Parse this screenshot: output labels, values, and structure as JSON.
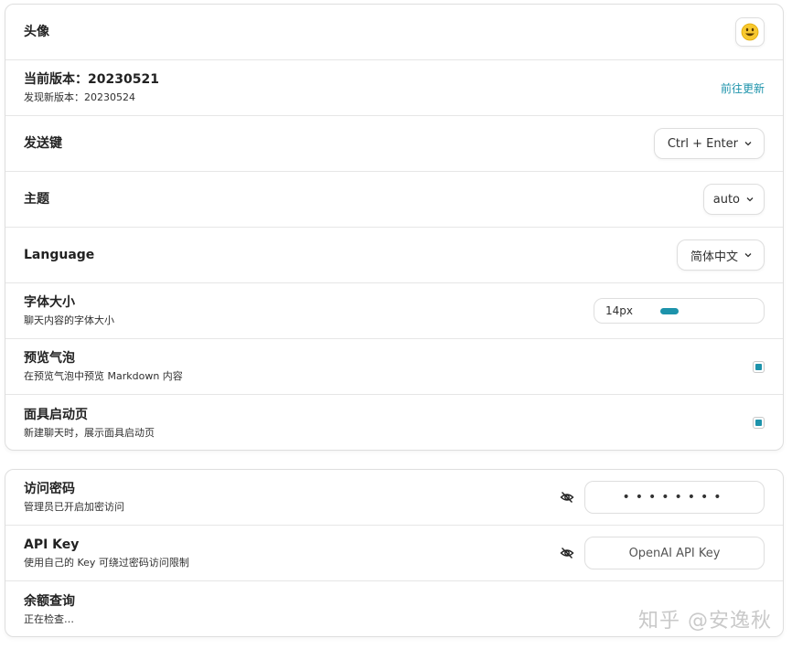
{
  "settings_card": {
    "avatar": {
      "label": "头像",
      "emoji": "😃"
    },
    "version": {
      "label": "当前版本：20230521",
      "sub": "发现新版本：20230524",
      "update_link": "前往更新"
    },
    "send_key": {
      "label": "发送键",
      "value": "Ctrl + Enter"
    },
    "theme": {
      "label": "主题",
      "value": "auto"
    },
    "language": {
      "label": "Language",
      "value": "简体中文"
    },
    "font_size": {
      "label": "字体大小",
      "sub": "聊天内容的字体大小",
      "value": "14px",
      "slider_fraction": 0.15
    },
    "preview_bubble": {
      "label": "预览气泡",
      "sub": "在预览气泡中预览 Markdown 内容",
      "checked": true
    },
    "mask_launch": {
      "label": "面具启动页",
      "sub": "新建聊天时，展示面具启动页",
      "checked": true
    }
  },
  "access_card": {
    "access_code": {
      "label": "访问密码",
      "sub": "管理员已开启加密访问",
      "value": "••••••••"
    },
    "api_key": {
      "label": "API Key",
      "sub": "使用自己的 Key 可绕过密码访问限制",
      "placeholder": "OpenAI API Key"
    },
    "balance": {
      "label": "余额查询",
      "sub": "正在检查…"
    }
  },
  "watermark": "知乎 @安逸秋",
  "colors": {
    "accent": "#1d93ab",
    "border": "#dedede"
  }
}
